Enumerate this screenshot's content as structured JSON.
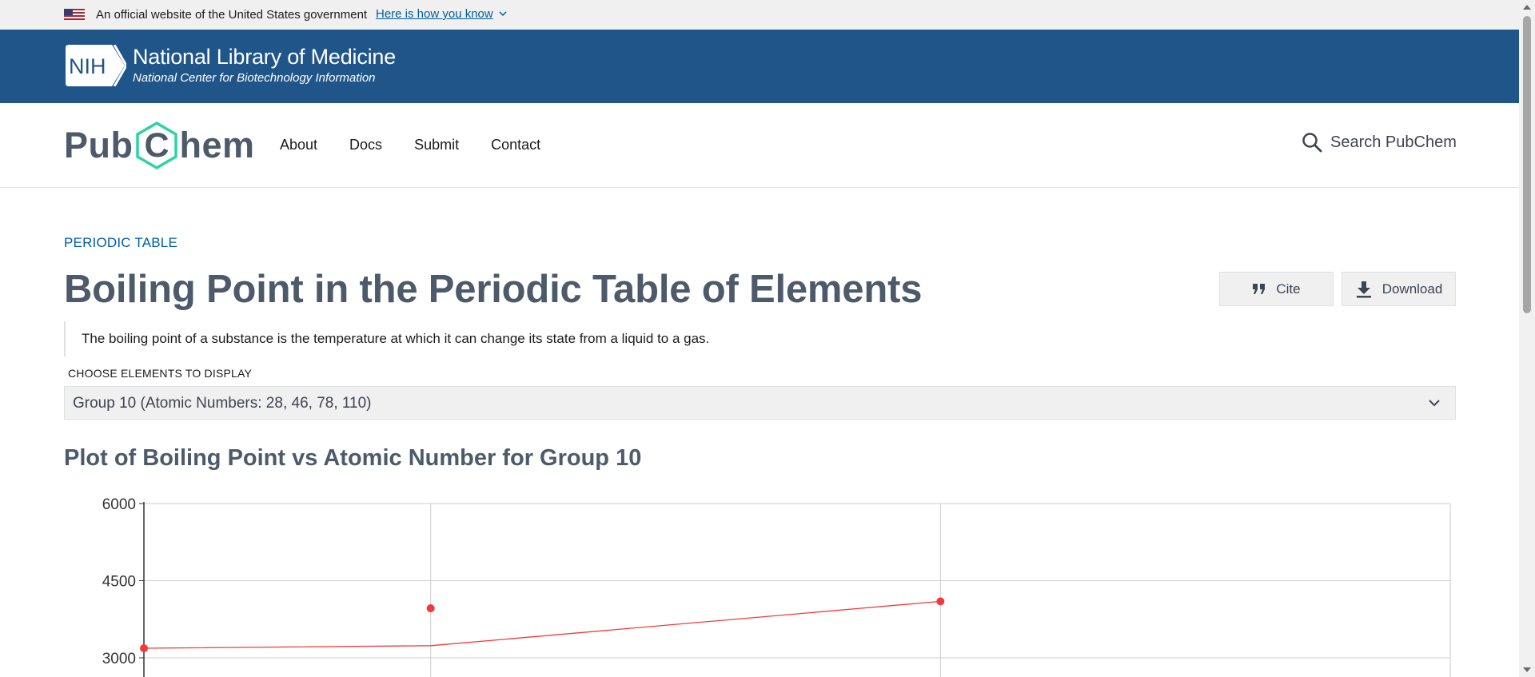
{
  "gov_banner": {
    "text": "An official website of the United States government",
    "link": "Here is how you know"
  },
  "nih": {
    "title": "National Library of Medicine",
    "subtitle": "National Center for Biotechnology Information",
    "logo_text": "NIH"
  },
  "nav": {
    "logo_left": "Pub",
    "logo_mid": "C",
    "logo_right": "hem",
    "links": [
      "About",
      "Docs",
      "Submit",
      "Contact"
    ],
    "search_label": "Search PubChem"
  },
  "main": {
    "breadcrumb": "PERIODIC TABLE",
    "title": "Boiling Point in the Periodic Table of Elements",
    "cite_label": "Cite",
    "download_label": "Download",
    "description": "The boiling point of a substance is the temperature at which it can change its state from a liquid to a gas.",
    "choose_label": "CHOOSE ELEMENTS TO DISPLAY",
    "selected_option": "Group 10 (Atomic Numbers: 28, 46, 78, 110)",
    "plot_title": "Plot of Boiling Point vs Atomic Number for Group 10"
  },
  "colors": {
    "accent": "#20558a",
    "link": "#005ea2",
    "title": "#4d5a6a",
    "series": "#f23a3a",
    "logo_hex": "#2ed3a5"
  },
  "chart_data": {
    "type": "scatter",
    "title": "",
    "xlabel": "",
    "ylabel": "",
    "ylim": [
      2400,
      6000
    ],
    "xlim": [
      28,
      110
    ],
    "yticks": [
      6000,
      4500,
      3000
    ],
    "grid": true,
    "series": [
      {
        "kind": "points",
        "x": [
          28,
          46,
          78
        ],
        "y": [
          3186,
          3963,
          4098
        ]
      },
      {
        "kind": "line",
        "x": [
          28,
          46,
          78
        ],
        "y": [
          3186,
          3236,
          4098
        ]
      }
    ]
  }
}
